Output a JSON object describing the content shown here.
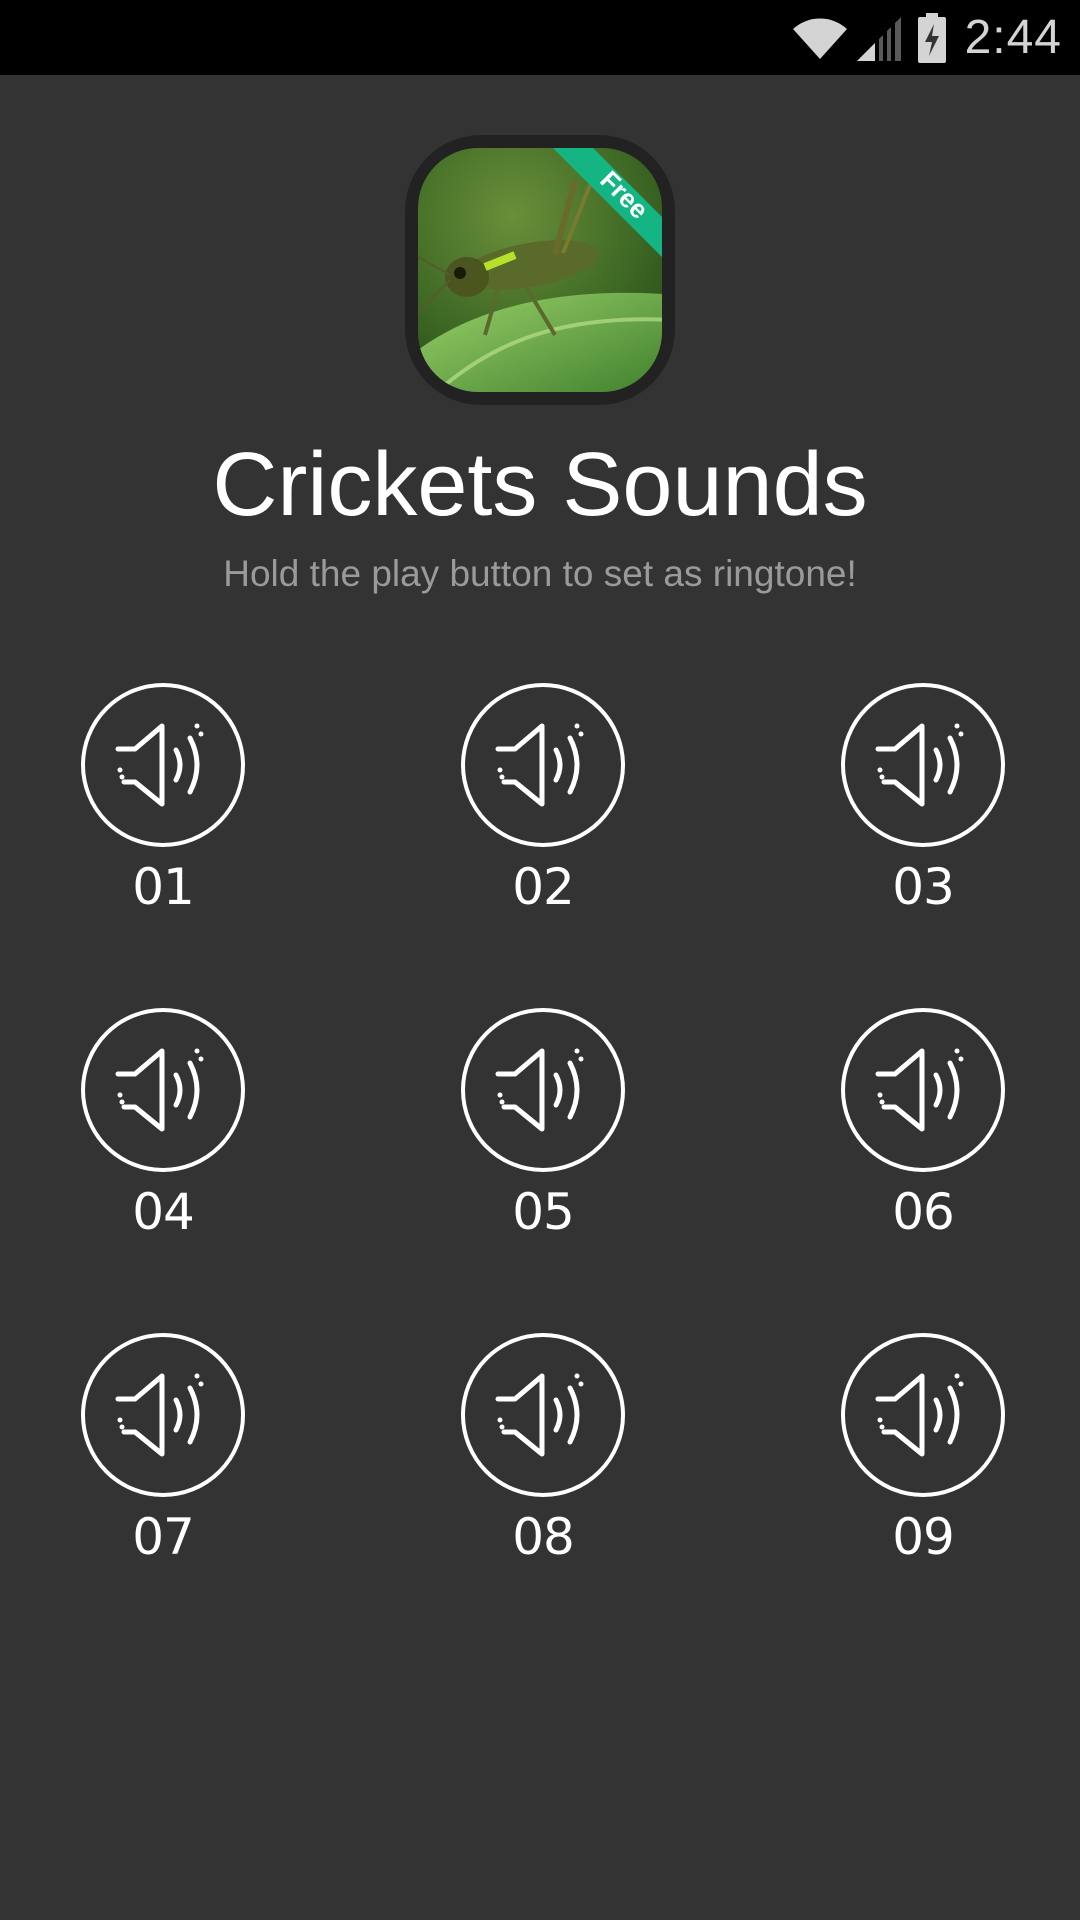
{
  "status_bar": {
    "time": "2:44",
    "icons": [
      "wifi-icon",
      "cell-signal-icon",
      "battery-charging-icon"
    ]
  },
  "app": {
    "title": "Crickets Sounds",
    "subtitle": "Hold the play button to set as ringtone!",
    "icon_badge": "Free",
    "badge_color": "#15b583"
  },
  "sounds": [
    {
      "label": "01",
      "icon": "speaker-icon"
    },
    {
      "label": "02",
      "icon": "speaker-icon"
    },
    {
      "label": "03",
      "icon": "speaker-icon"
    },
    {
      "label": "04",
      "icon": "speaker-icon"
    },
    {
      "label": "05",
      "icon": "speaker-icon"
    },
    {
      "label": "06",
      "icon": "speaker-icon"
    },
    {
      "label": "07",
      "icon": "speaker-icon"
    },
    {
      "label": "08",
      "icon": "speaker-icon"
    },
    {
      "label": "09",
      "icon": "speaker-icon"
    }
  ],
  "colors": {
    "background": "#333333",
    "status_bar": "#000000",
    "text_primary": "#ffffff",
    "text_secondary": "#9a9a9a"
  }
}
